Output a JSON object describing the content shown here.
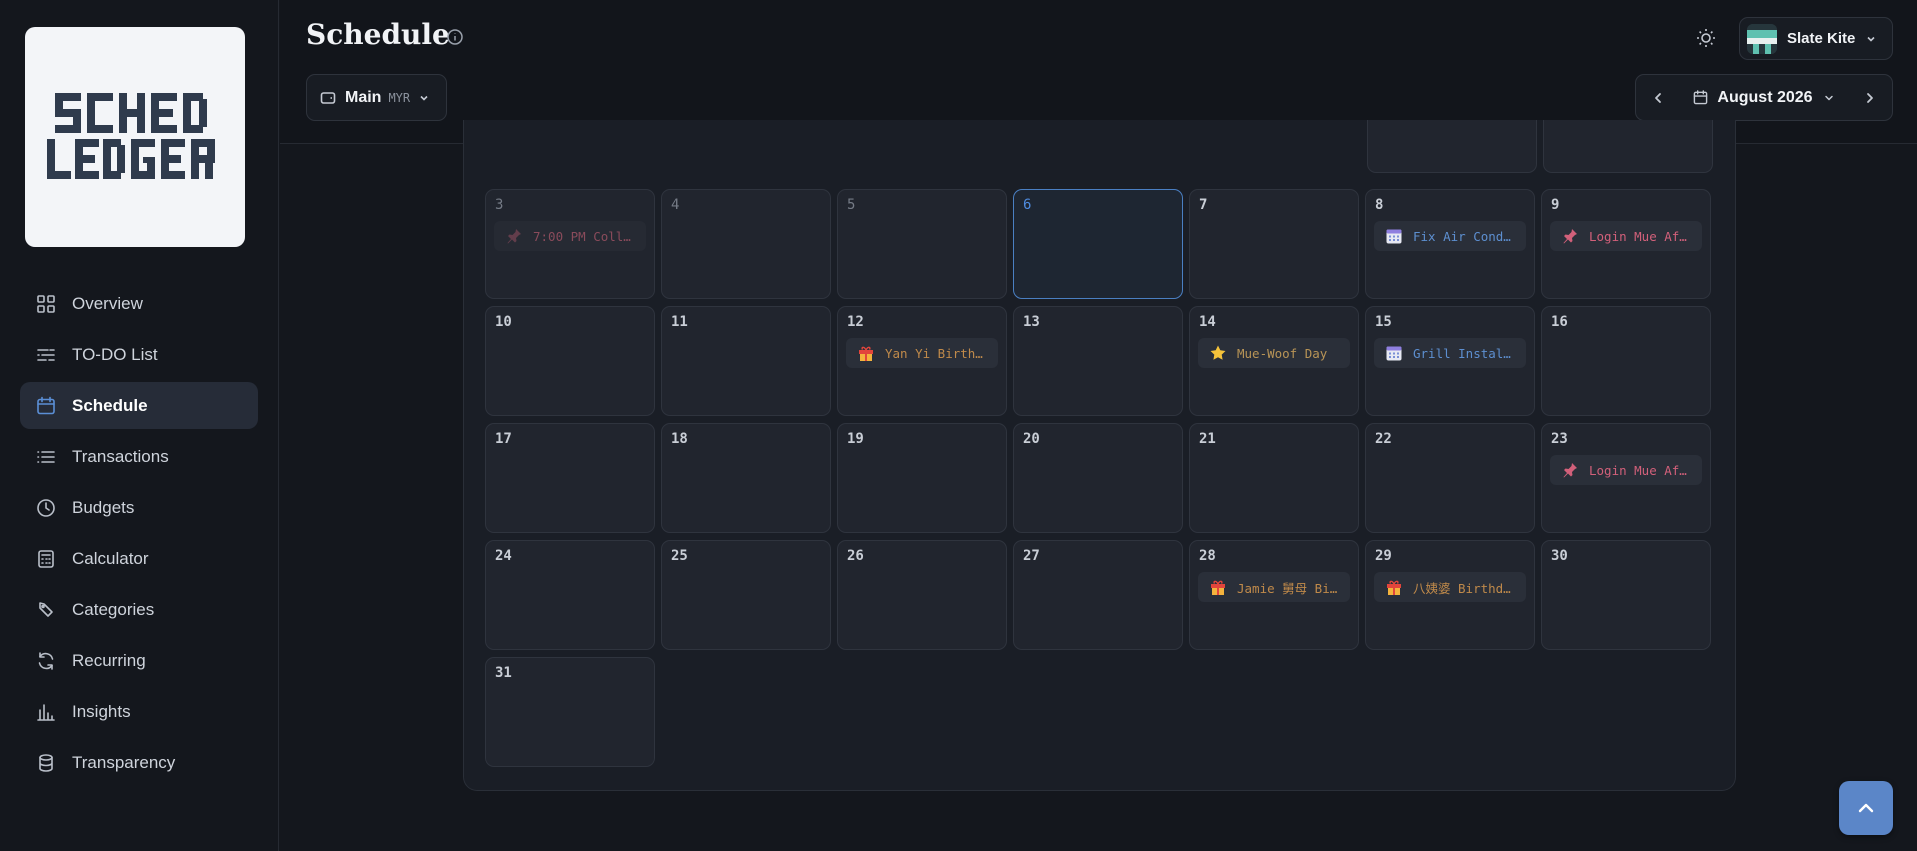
{
  "app": {
    "logo_text": "SCHED LEDGER"
  },
  "sidebar": {
    "items": [
      {
        "label": "Overview",
        "icon": "grid-icon",
        "active": false
      },
      {
        "label": "TO-DO List",
        "icon": "list-lines-icon",
        "active": false
      },
      {
        "label": "Schedule",
        "icon": "calendar-icon",
        "active": true
      },
      {
        "label": "Transactions",
        "icon": "bullet-list-icon",
        "active": false
      },
      {
        "label": "Budgets",
        "icon": "clock-icon",
        "active": false
      },
      {
        "label": "Calculator",
        "icon": "calculator-icon",
        "active": false
      },
      {
        "label": "Categories",
        "icon": "tag-icon",
        "active": false
      },
      {
        "label": "Recurring",
        "icon": "refresh-icon",
        "active": false
      },
      {
        "label": "Insights",
        "icon": "bar-chart-icon",
        "active": false
      },
      {
        "label": "Transparency",
        "icon": "database-icon",
        "active": false
      }
    ]
  },
  "header": {
    "title": "Schedule",
    "account": {
      "name": "Main",
      "currency": "MYR"
    },
    "user": {
      "name": "Slate Kite"
    },
    "month_label": "August 2026"
  },
  "calendar": {
    "today": 6,
    "days": [
      {
        "day": "3",
        "past": true,
        "event": {
          "text": "7:00 PM Coll…",
          "icon": "pushpin-icon",
          "color": "#8a4b5b",
          "muted": true
        }
      },
      {
        "day": "4",
        "past": true
      },
      {
        "day": "5",
        "past": true
      },
      {
        "day": "6",
        "today": true
      },
      {
        "day": "7"
      },
      {
        "day": "8",
        "event": {
          "text": "Fix Air Cond…",
          "icon": "calendar-event-icon",
          "color": "#5d8fd0"
        }
      },
      {
        "day": "9",
        "event": {
          "text": "Login Mue Af…",
          "icon": "pushpin-icon",
          "color": "#d2607a"
        }
      },
      {
        "day": "10"
      },
      {
        "day": "11"
      },
      {
        "day": "12",
        "event": {
          "text": "Yan Yi Birth…",
          "icon": "gift-icon",
          "color": "#c08a4a"
        }
      },
      {
        "day": "13"
      },
      {
        "day": "14",
        "event": {
          "text": "Mue-Woof Day",
          "icon": "star-icon",
          "color": "#b89456"
        }
      },
      {
        "day": "15",
        "event": {
          "text": "Grill Instal…",
          "icon": "calendar-event-icon",
          "color": "#5d8fd0"
        }
      },
      {
        "day": "16"
      },
      {
        "day": "17"
      },
      {
        "day": "18"
      },
      {
        "day": "19"
      },
      {
        "day": "20"
      },
      {
        "day": "21"
      },
      {
        "day": "22"
      },
      {
        "day": "23",
        "event": {
          "text": "Login Mue Af…",
          "icon": "pushpin-icon",
          "color": "#d2607a"
        }
      },
      {
        "day": "24"
      },
      {
        "day": "25"
      },
      {
        "day": "26"
      },
      {
        "day": "27"
      },
      {
        "day": "28",
        "event": {
          "text": "Jamie 舅母 Bi…",
          "icon": "gift-icon",
          "color": "#c08a4a"
        }
      },
      {
        "day": "29",
        "event": {
          "text": "八姨婆 Birthd…",
          "icon": "gift-icon",
          "color": "#c08a4a"
        }
      },
      {
        "day": "30"
      },
      {
        "day": "31"
      }
    ]
  },
  "colors": {
    "accent": "#5b86c8",
    "today_border": "#4a7fc2"
  }
}
